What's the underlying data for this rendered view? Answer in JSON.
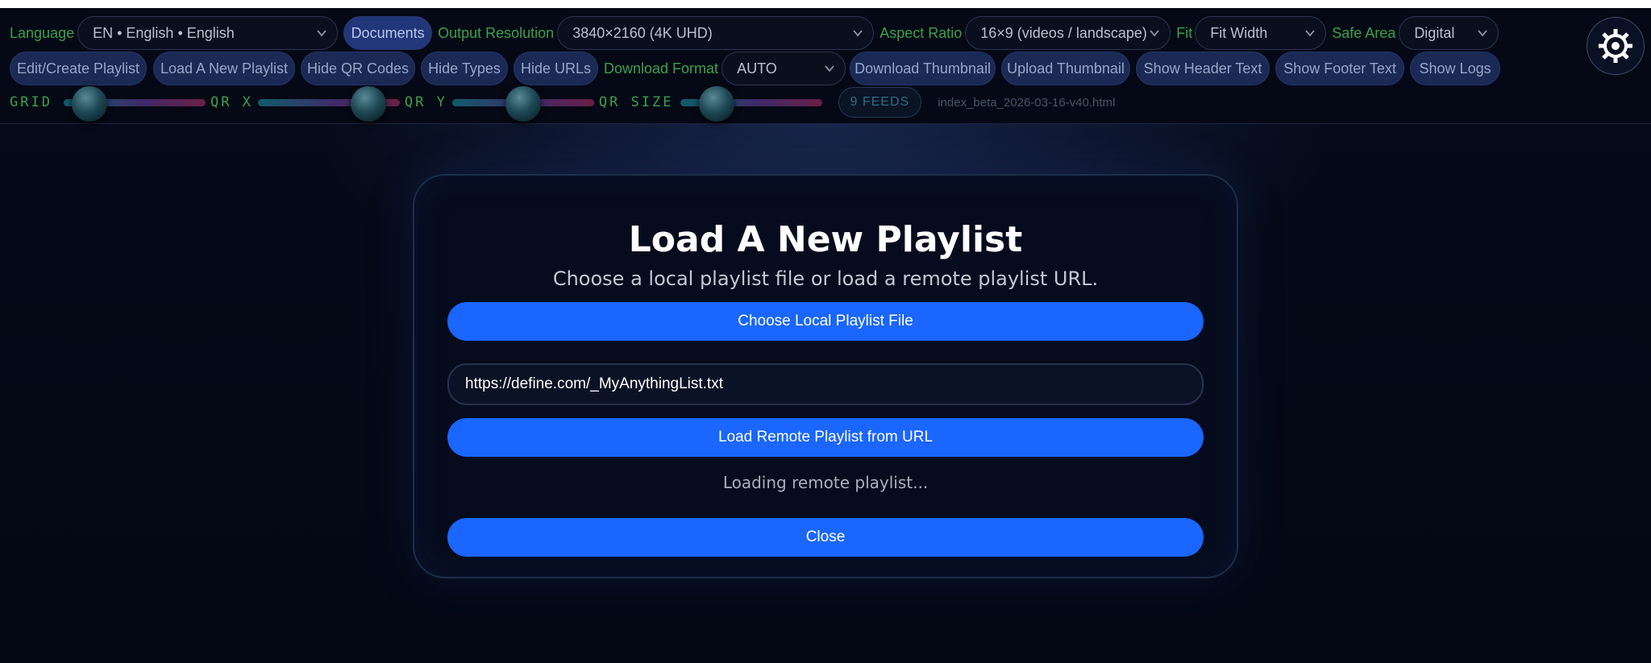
{
  "toolbar": {
    "language_label": "Language",
    "language_value": "EN • English • English",
    "documents_label": "Documents",
    "output_resolution_label": "Output Resolution",
    "output_resolution_value": "3840×2160 (4K UHD)",
    "aspect_ratio_label": "Aspect Ratio",
    "aspect_ratio_value": "16×9 (videos / landscape)",
    "fit_label": "Fit",
    "fit_value": "Fit Width",
    "safe_area_label": "Safe Area",
    "safe_area_value": "Digital",
    "edit_create_playlist": "Edit/Create Playlist",
    "load_new_playlist": "Load A New Playlist",
    "hide_qr_codes": "Hide QR Codes",
    "hide_types": "Hide Types",
    "hide_urls": "Hide URLs",
    "download_format_label": "Download Format",
    "download_format_value": "AUTO",
    "download_thumbnail": "Download Thumbnail",
    "upload_thumbnail": "Upload Thumbnail",
    "show_header_text": "Show Header Text",
    "show_footer_text": "Show Footer Text",
    "show_logs": "Show Logs",
    "grid_label": "GRID",
    "qr_x_label": "QR X",
    "qr_y_label": "QR Y",
    "qr_size_label": "QR SIZE",
    "grid_level": 0.18,
    "qr_x_level": 0.78,
    "qr_y_level": 0.5,
    "qr_size_level": 0.26,
    "feeds_badge": "9 FEEDS",
    "filename": "index_beta_2026-03-16-v40.html"
  },
  "icons": {
    "settings": "gear-icon",
    "dropdown": "chevron-down-icon"
  },
  "modal": {
    "title": "Load A New Playlist",
    "subtitle": "Choose a local playlist file or load a remote playlist URL.",
    "choose_local_button": "Choose Local Playlist File",
    "url_value": "https://define.com/_MyAnythingList.txt",
    "load_remote_button": "Load Remote Playlist from URL",
    "status": "Loading remote playlist...",
    "close_button": "Close"
  },
  "colors": {
    "accent_blue": "#1a66ff",
    "label_green": "#3aa14a",
    "background": "#040814"
  }
}
